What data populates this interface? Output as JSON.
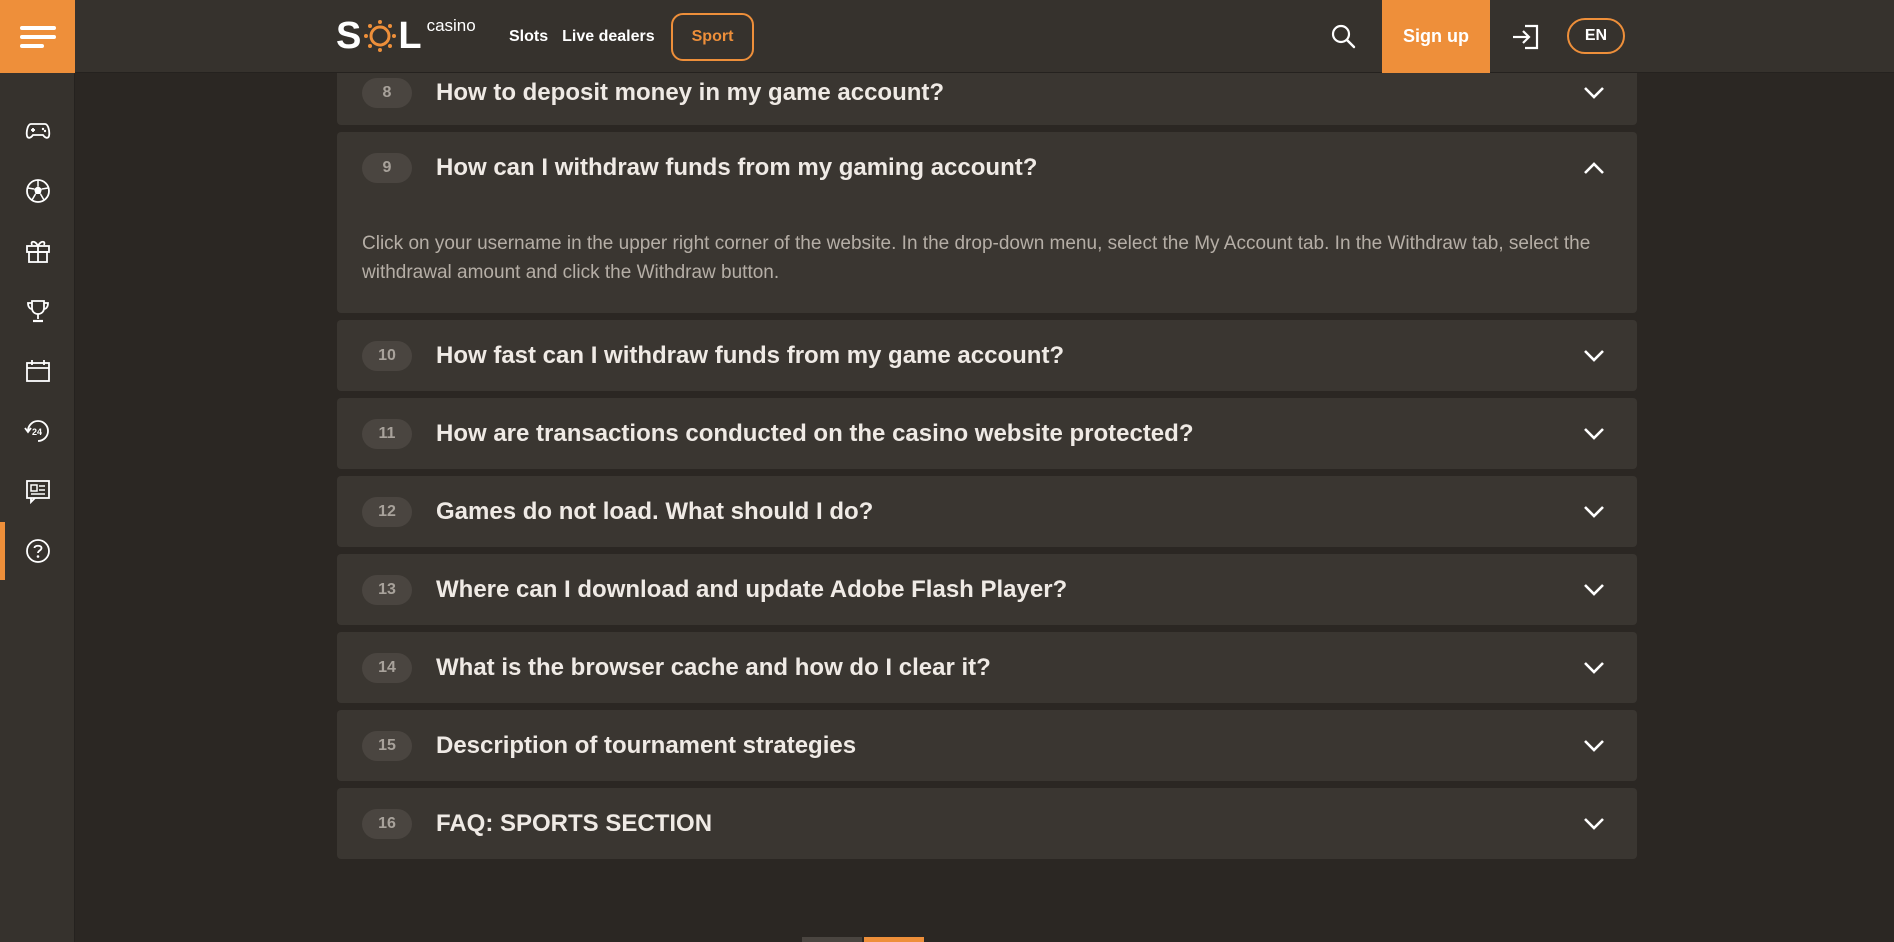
{
  "header": {
    "logo_text": "SOL",
    "logo_sub": "casino",
    "nav": [
      {
        "label": "Slots"
      },
      {
        "label": "Live dealers"
      },
      {
        "label": "Sport"
      }
    ],
    "signup_label": "Sign up",
    "language": "EN",
    "accent_color": "#ee8f3a"
  },
  "sidebar": {
    "items": [
      {
        "icon": "gamepad-icon"
      },
      {
        "icon": "soccer-ball-icon"
      },
      {
        "icon": "gift-icon"
      },
      {
        "icon": "trophy-icon"
      },
      {
        "icon": "calendar-icon"
      },
      {
        "icon": "support-24-icon"
      },
      {
        "icon": "news-icon"
      },
      {
        "icon": "help-icon",
        "active": true
      }
    ]
  },
  "faq": [
    {
      "num": "8",
      "question": "How to deposit money in my game account?"
    },
    {
      "num": "9",
      "question": "How can I withdraw funds from my gaming account?",
      "expanded": true,
      "answer": "Click on your username in the upper right corner of the website. In the drop-down menu, select the My Account tab. In the Withdraw tab, select the withdrawal amount and click the Withdraw button."
    },
    {
      "num": "10",
      "question": "How fast can I withdraw funds from my game account?"
    },
    {
      "num": "11",
      "question": "How are transactions conducted on the casino website protected?"
    },
    {
      "num": "12",
      "question": "Games do not load. What should I do?"
    },
    {
      "num": "13",
      "question": "Where can I download and update Adobe Flash Player?"
    },
    {
      "num": "14",
      "question": "What is the browser cache and how do I clear it?"
    },
    {
      "num": "15",
      "question": "Description of tournament strategies"
    },
    {
      "num": "16",
      "question": "FAQ: SPORTS SECTION"
    }
  ]
}
